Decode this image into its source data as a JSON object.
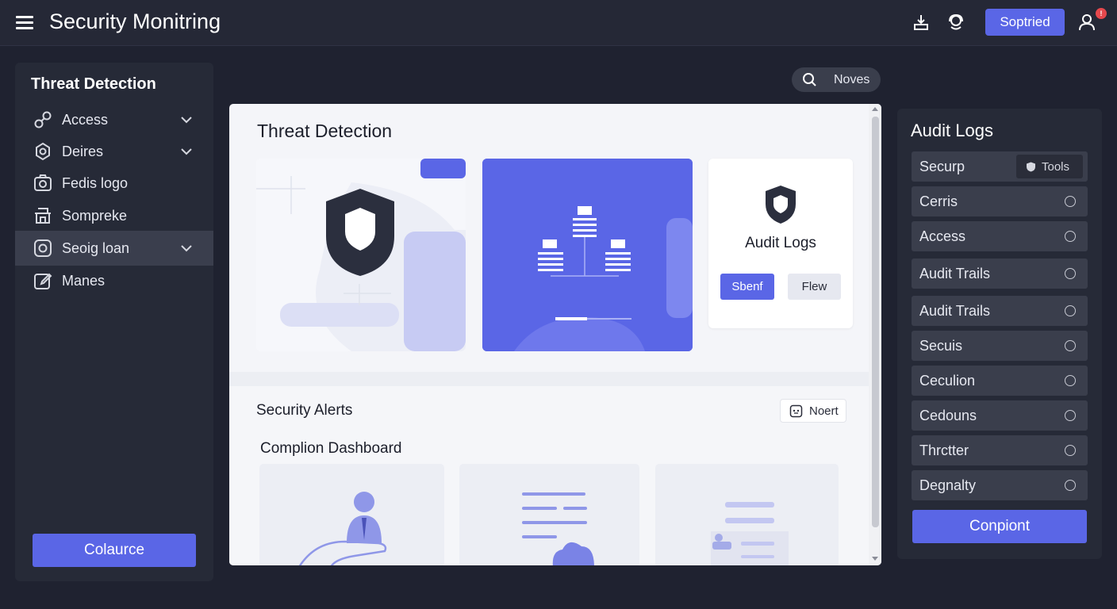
{
  "header": {
    "title": "Security Monitring",
    "primary_button": "Soptried",
    "notification_count": "!",
    "icons": [
      "menu-icon",
      "download-icon",
      "support-icon",
      "user-icon"
    ]
  },
  "sidebar": {
    "title": "Threat Detection",
    "items": [
      {
        "label": "Access",
        "icon": "link-icon",
        "has_chevron": true
      },
      {
        "label": "Deires",
        "icon": "settings-icon",
        "has_chevron": true
      },
      {
        "label": "Fedis logo",
        "icon": "camera-icon",
        "has_chevron": false
      },
      {
        "label": "Somprekе",
        "icon": "building-icon",
        "has_chevron": false
      },
      {
        "label": "Seoig loan",
        "icon": "instagram-icon",
        "has_chevron": true,
        "active": true
      },
      {
        "label": "Manes",
        "icon": "edit-icon",
        "has_chevron": false
      }
    ],
    "bottom_button": "Colaurce"
  },
  "search": {
    "label": "Noves"
  },
  "main": {
    "title": "Threat Detection",
    "card3": {
      "title": "Audit Logs",
      "primary_button": "Sbenf",
      "secondary_button": "Flew"
    },
    "alerts": {
      "title": "Security Alerts",
      "action_button": "Noert",
      "subtitle": "Complion Dashboard"
    }
  },
  "audit": {
    "title": "Audit Logs",
    "tools_label": "Tools",
    "rows": [
      "Securp",
      "Cerris",
      "Access",
      "Audit Trails",
      "Audit Trails",
      "Secuis",
      "Ceculion",
      "Cedouns",
      "Thrctter",
      "Degnalty"
    ],
    "bottom_button": "Conpiont"
  },
  "colors": {
    "accent": "#5a66e6",
    "background": "#1f2230",
    "panel": "#262a37",
    "row": "#3a3e4c",
    "main_panel": "#f4f5f9",
    "shield": "#2b2f3e",
    "notification": "#e5484d"
  }
}
